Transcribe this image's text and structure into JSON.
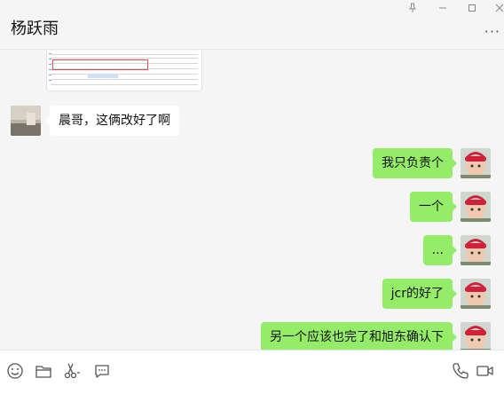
{
  "header": {
    "title": "杨跃雨",
    "more_icon": "more-dots-icon"
  },
  "window_controls": [
    "pin-icon",
    "minimize-icon",
    "maximize-icon",
    "close-icon"
  ],
  "messages": [
    {
      "direction": "incoming",
      "type": "image"
    },
    {
      "direction": "incoming",
      "text": "晨哥，这俩改好了啊"
    },
    {
      "direction": "outgoing",
      "text": "我只负责个"
    },
    {
      "direction": "outgoing",
      "text": "一个"
    },
    {
      "direction": "outgoing",
      "text": "..."
    },
    {
      "direction": "outgoing",
      "text": "jcr的好了"
    },
    {
      "direction": "outgoing",
      "text": "另一个应该也完了和旭东确认下"
    }
  ],
  "toolbar": {
    "left_icons": [
      "emoji-icon",
      "folder-icon",
      "scissors-icon",
      "chat-bubble-icon"
    ],
    "right_icons": [
      "phone-icon",
      "video-icon"
    ]
  },
  "colors": {
    "outgoing_bubble": "#95ec69",
    "incoming_bubble": "#ffffff",
    "background": "#f5f5f5"
  }
}
